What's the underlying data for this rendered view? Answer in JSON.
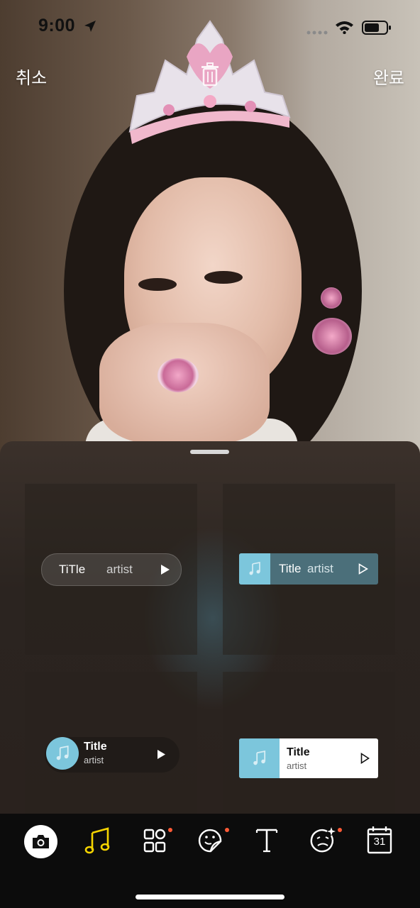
{
  "status_bar": {
    "time": "9:00"
  },
  "top_bar": {
    "cancel_label": "취소",
    "done_label": "완료"
  },
  "stickers": [
    {
      "style": "pill-translucent",
      "title": "TiTle",
      "artist": "artist"
    },
    {
      "style": "bar-blue",
      "title": "Title",
      "artist": "artist"
    },
    {
      "style": "round-dark",
      "title": "Title",
      "artist": "artist"
    },
    {
      "style": "card-white",
      "title": "Title",
      "artist": "artist"
    }
  ],
  "toolbar": {
    "tools": [
      {
        "name": "camera",
        "icon": "camera-icon",
        "active": true
      },
      {
        "name": "music",
        "icon": "music-note-icon",
        "selected": true
      },
      {
        "name": "widgets",
        "icon": "grid-shapes-icon",
        "badge": true
      },
      {
        "name": "sticker",
        "icon": "sticker-face-icon",
        "badge": true
      },
      {
        "name": "text",
        "icon": "text-icon"
      },
      {
        "name": "effects",
        "icon": "sparkle-face-icon",
        "badge": true
      },
      {
        "name": "date",
        "icon": "calendar-icon",
        "label": "31"
      }
    ]
  },
  "colors": {
    "accent_yellow": "#f5d400",
    "badge_orange": "#ff5a36",
    "album_blue": "#7cc6dc",
    "sheet_bg": "#2b2420"
  }
}
